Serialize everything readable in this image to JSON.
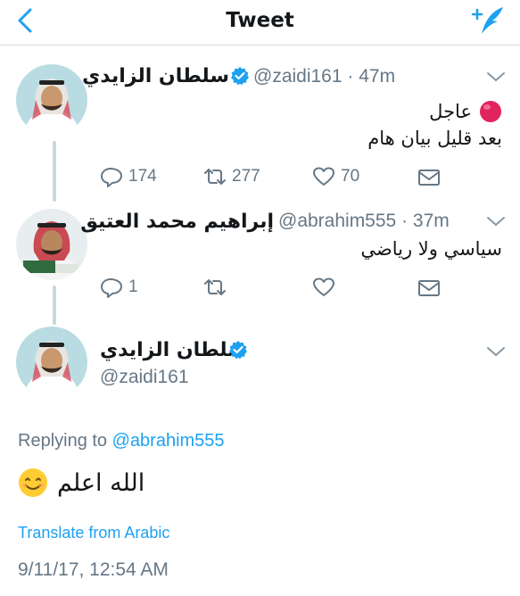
{
  "header": {
    "title": "Tweet"
  },
  "tweets": [
    {
      "name": "سلطان الزايدي",
      "handle": "@zaidi161",
      "time": "· 47m",
      "lines": [
        "عاجل",
        "بعد قليل بيان هام"
      ],
      "replies": "174",
      "retweets": "277",
      "likes": "70"
    },
    {
      "name": "إبراهيم محمد العتيق",
      "handle": "@abrahim555",
      "time": "· 37m",
      "lines": [
        "سياسي ولا رياضي"
      ],
      "replies": "1",
      "retweets": "",
      "likes": ""
    }
  ],
  "main": {
    "name": "سلطان الزايدي",
    "handle": "@zaidi161",
    "replying_label": "Replying to",
    "replying_to": "@abrahim555",
    "text": "الله اعلم",
    "emoji": "😊",
    "translate": "Translate from Arabic",
    "timestamp": "9/11/17, 12:54 AM"
  },
  "colors": {
    "accent": "#1da1f2",
    "secondary": "#657786",
    "divider": "#d6dbe0",
    "red_dot": "#e0245e"
  }
}
